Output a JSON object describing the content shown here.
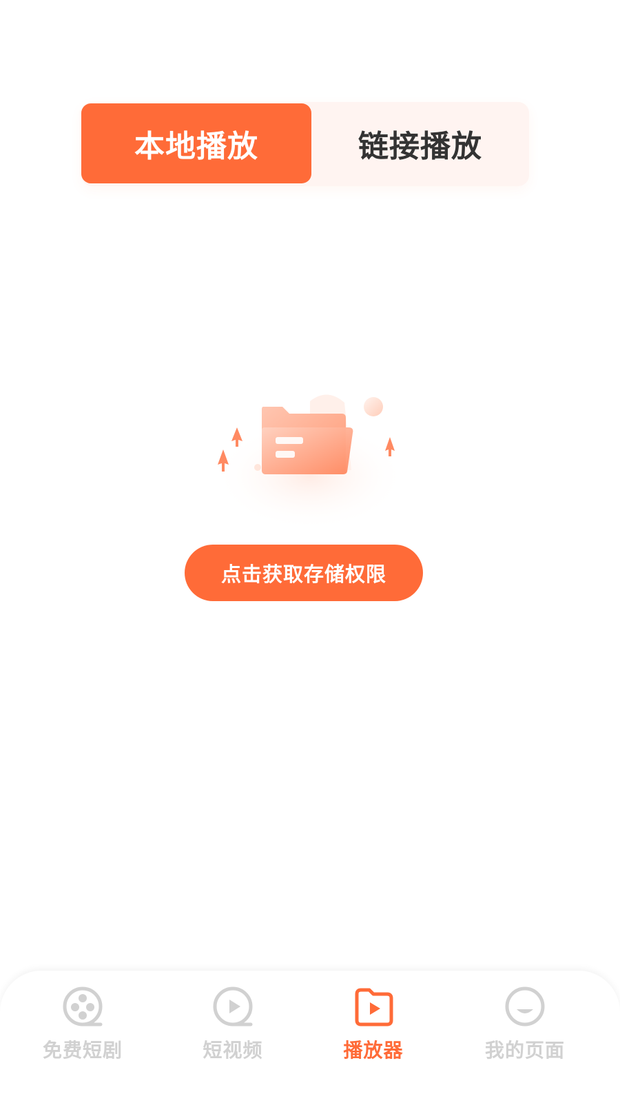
{
  "tabs": {
    "local": "本地播放",
    "link": "链接播放",
    "selected": "local"
  },
  "empty_state": {
    "illustration_icon": "folder-icon",
    "button_label": "点击获取存储权限"
  },
  "bottom_nav": {
    "items": [
      {
        "label": "免费短剧",
        "icon": "film-reel-icon",
        "active": false
      },
      {
        "label": "短视频",
        "icon": "play-circle-icon",
        "active": false
      },
      {
        "label": "播放器",
        "icon": "folder-play-icon",
        "active": true
      },
      {
        "label": "我的页面",
        "icon": "smile-icon",
        "active": false
      }
    ]
  },
  "colors": {
    "accent": "#ff6b38",
    "inactive": "#d1d1d1",
    "segment_bg": "#fff4f1"
  }
}
